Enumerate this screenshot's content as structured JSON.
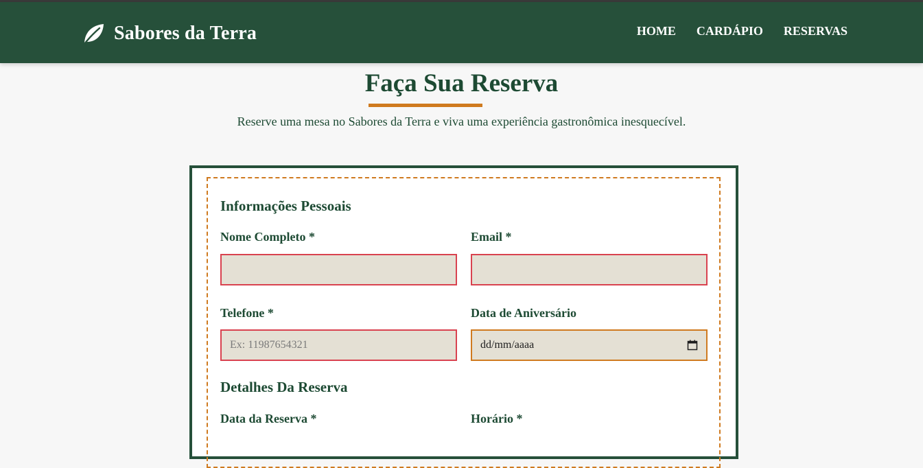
{
  "brand": {
    "name": "Sabores da Terra",
    "icon": "leaf-icon"
  },
  "nav": {
    "items": [
      {
        "label": "HOME"
      },
      {
        "label": "CARDÁPIO"
      },
      {
        "label": "RESERVAS"
      }
    ]
  },
  "page": {
    "title": "Faça Sua Reserva",
    "subtitle": "Reserve uma mesa no Sabores da Terra e viva uma experiência gastronômica inesquecível."
  },
  "form": {
    "personal": {
      "title": "Informações Pessoais",
      "name_label": "Nome Completo *",
      "name_value": "",
      "email_label": "Email *",
      "email_value": "",
      "phone_label": "Telefone *",
      "phone_placeholder": "Ex: 11987654321",
      "birthday_label": "Data de Aniversário",
      "birthday_value": "dd/mm/aaaa"
    },
    "reservation": {
      "title": "Detalhes Da Reserva",
      "date_label": "Data da Reserva *",
      "time_label": "Horário *"
    }
  },
  "colors": {
    "header_bg": "#26503a",
    "accent": "#cf7a1f",
    "invalid_border": "#d9424f",
    "input_bg": "#e4e0d4",
    "text_dark_green": "#1d4a33"
  }
}
